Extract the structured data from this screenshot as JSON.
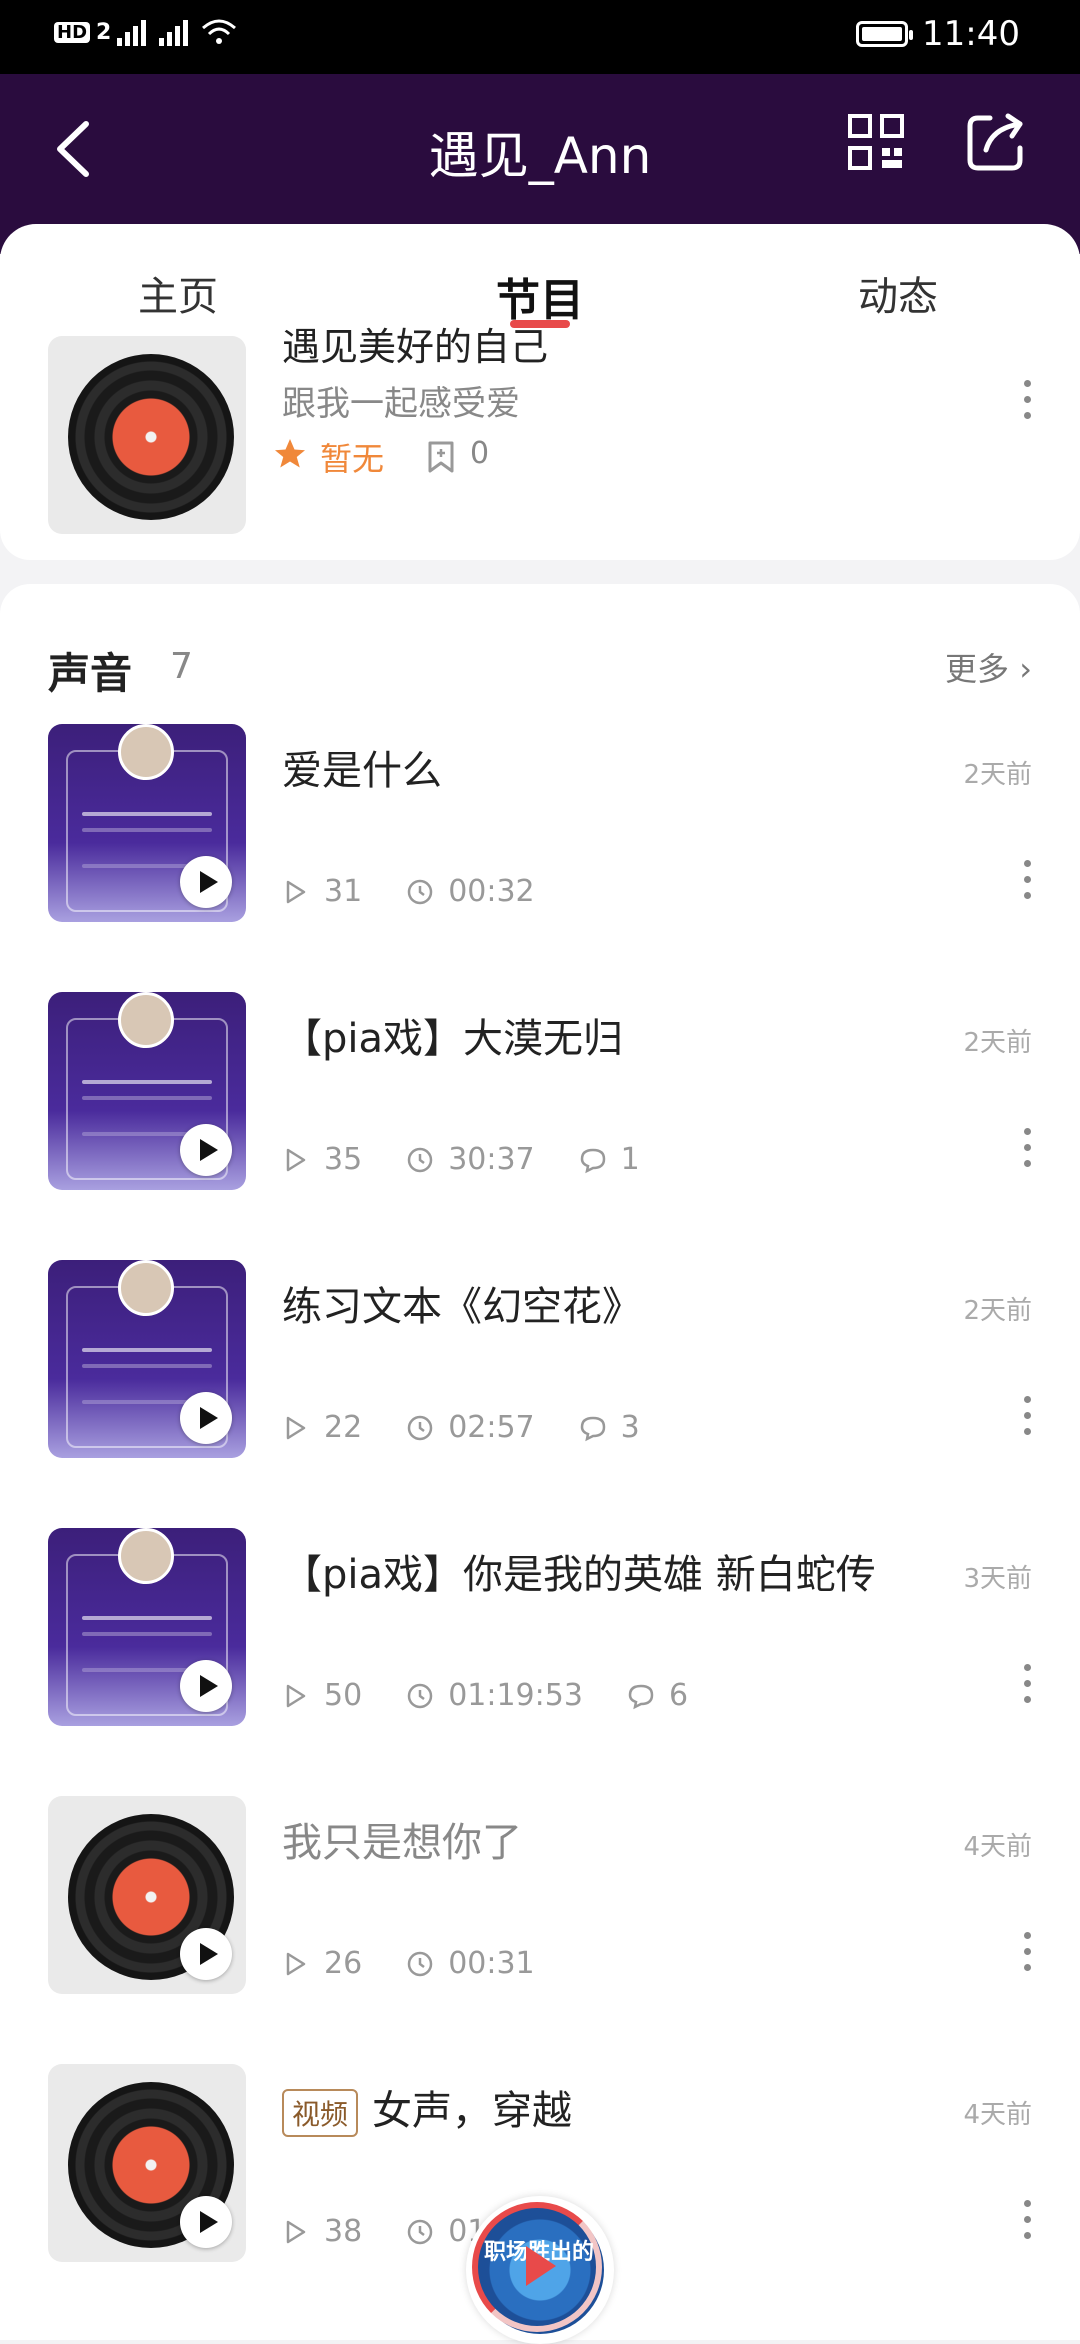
{
  "status_bar": {
    "left_text": "HD 2  4G  4G",
    "time": "11:40"
  },
  "header": {
    "title": "遇见_Ann"
  },
  "tabs": [
    {
      "label": "主页"
    },
    {
      "label": "节目"
    },
    {
      "label": "动态"
    }
  ],
  "program": {
    "title": "遇见美好的自己",
    "subtitle": "跟我一起感受爱",
    "rating": "暂无",
    "bookmark_count": "0"
  },
  "sounds": {
    "section_title": "声音",
    "count": "7",
    "more_label": "更多",
    "items": [
      {
        "title": "爱是什么",
        "time": "2天前",
        "plays": "31",
        "duration": "00:32",
        "comments": ""
      },
      {
        "title": "【pia戏】大漠无归",
        "time": "2天前",
        "plays": "35",
        "duration": "30:37",
        "comments": "1"
      },
      {
        "title": "练习文本《幻空花》",
        "time": "2天前",
        "plays": "22",
        "duration": "02:57",
        "comments": "3"
      },
      {
        "title": "【pia戏】你是我的英雄 新白蛇传",
        "time": "3天前",
        "plays": "50",
        "duration": "01:19:53",
        "comments": "6"
      },
      {
        "title": "我只是想你了",
        "time": "4天前",
        "plays": "26",
        "duration": "00:31",
        "comments": ""
      },
      {
        "title": "女声，穿越",
        "tag": "视频",
        "time": "4天前",
        "plays": "38",
        "duration": "01",
        "comments": ""
      }
    ]
  },
  "floating_player": {
    "label": "职场胜出的"
  },
  "colors": {
    "header_bg": "#2a0c3e",
    "accent": "#e84a4a",
    "star": "#f0883a"
  }
}
